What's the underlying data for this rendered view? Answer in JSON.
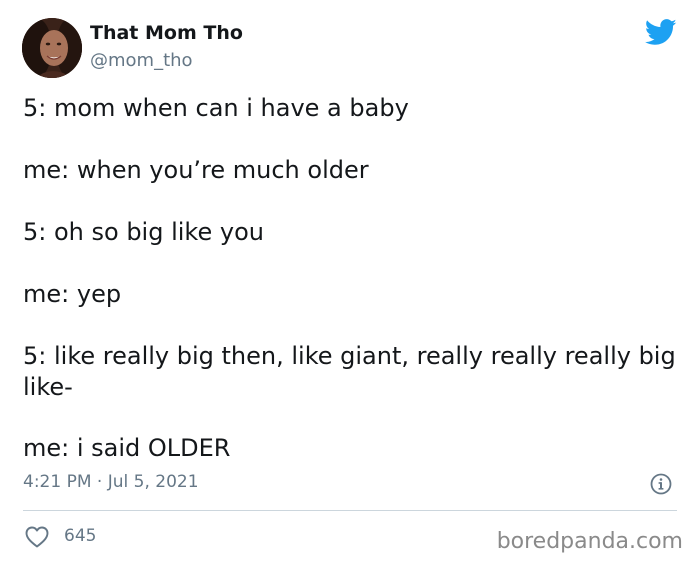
{
  "author": {
    "display_name": "That Mom Tho",
    "handle": "@mom_tho",
    "avatar_icon": "profile-photo"
  },
  "brand_icon": "twitter-bird-icon",
  "brand_color": "#1da1f2",
  "tweet": {
    "lines": [
      "5: mom when can i have a baby",
      "me: when you’re much older",
      "5: oh so big like you",
      "me: yep",
      "5: like really big then, like giant, really really really big like-",
      "me: i said OLDER"
    ],
    "timestamp": "4:21 PM · Jul 5, 2021"
  },
  "actions": {
    "like_count": "645"
  },
  "watermark": "boredpanda.com"
}
